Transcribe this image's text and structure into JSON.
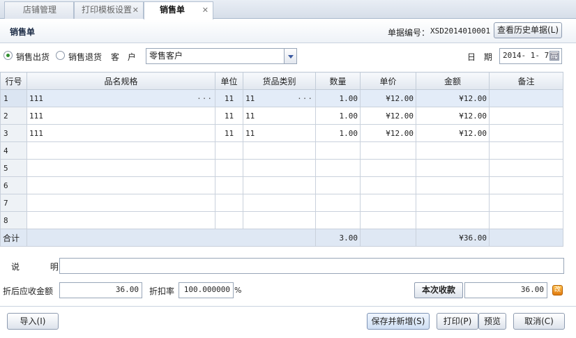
{
  "tabs": [
    {
      "label": "店铺管理",
      "active": false,
      "closable": false
    },
    {
      "label": "打印模板设置",
      "active": false,
      "closable": true
    },
    {
      "label": "销售单",
      "active": true,
      "closable": true
    }
  ],
  "header": {
    "title": "销售单",
    "doc_no_label": "单据编号：",
    "doc_no": "XSD2014010001",
    "history_button": "查看历史单据(L)"
  },
  "form": {
    "radio_out": "销售出货",
    "radio_return": "销售退货",
    "customer_label": "客 户",
    "customer_value": "零售客户",
    "date_label": "日 期",
    "date_value": "2014- 1- 7"
  },
  "grid": {
    "columns": [
      "行号",
      "品名规格",
      "单位",
      "货品类别",
      "数量",
      "单价",
      "金额",
      "备注"
    ],
    "rows": [
      {
        "no": "1",
        "name": "111",
        "unit": "11",
        "category": "11",
        "qty": "1.00",
        "price": "¥12.00",
        "amount": "¥12.00",
        "note": ""
      },
      {
        "no": "2",
        "name": "111",
        "unit": "11",
        "category": "11",
        "qty": "1.00",
        "price": "¥12.00",
        "amount": "¥12.00",
        "note": ""
      },
      {
        "no": "3",
        "name": "111",
        "unit": "11",
        "category": "11",
        "qty": "1.00",
        "price": "¥12.00",
        "amount": "¥12.00",
        "note": ""
      },
      {
        "no": "4",
        "name": "",
        "unit": "",
        "category": "",
        "qty": "",
        "price": "",
        "amount": "",
        "note": ""
      },
      {
        "no": "5",
        "name": "",
        "unit": "",
        "category": "",
        "qty": "",
        "price": "",
        "amount": "",
        "note": ""
      },
      {
        "no": "6",
        "name": "",
        "unit": "",
        "category": "",
        "qty": "",
        "price": "",
        "amount": "",
        "note": ""
      },
      {
        "no": "7",
        "name": "",
        "unit": "",
        "category": "",
        "qty": "",
        "price": "",
        "amount": "",
        "note": ""
      },
      {
        "no": "8",
        "name": "",
        "unit": "",
        "category": "",
        "qty": "",
        "price": "",
        "amount": "",
        "note": ""
      }
    ],
    "totals": {
      "label": "合计",
      "qty": "3.00",
      "amount": "¥36.00"
    },
    "ellipsis": "···"
  },
  "footer": {
    "remark_label": "说 明",
    "remark_value": "",
    "discounted_label": "折后应收金额",
    "discounted_value": "36.00",
    "rate_label": "折扣率",
    "rate_value": "100.000000",
    "rate_unit": "%",
    "received_label": "本次收款",
    "received_value": "36.00",
    "edit_icon_glyph": "改"
  },
  "buttons": {
    "import": "导入(I)",
    "save_new": "保存并新增(S)",
    "print": "打印(P)",
    "preview": "预览",
    "cancel": "取消(C)"
  },
  "icons": {
    "calendar": "calendar-icon",
    "dropdown": "chevron-down-icon",
    "close": "close-icon"
  }
}
